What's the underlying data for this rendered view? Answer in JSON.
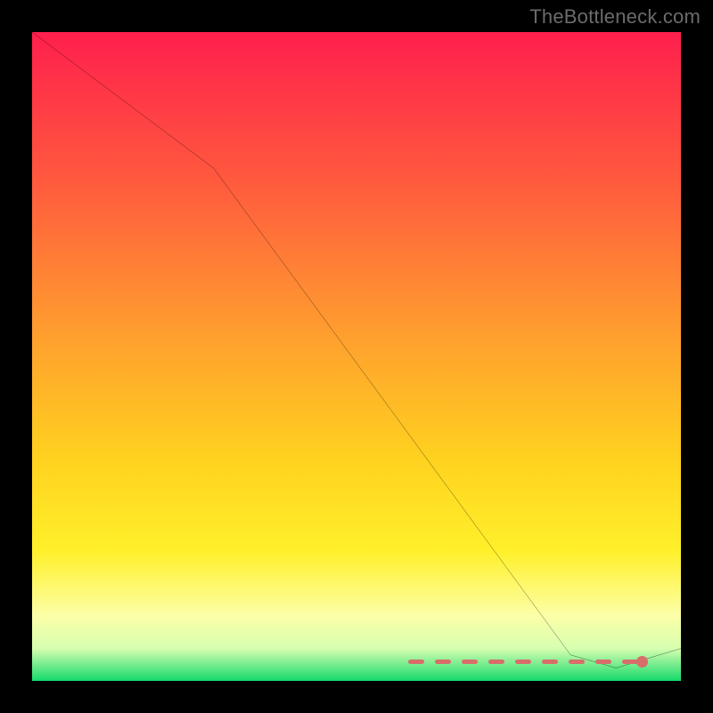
{
  "attribution": "TheBottleneck.com",
  "chart_data": {
    "type": "line",
    "title": "",
    "xlabel": "",
    "ylabel": "",
    "xlim": [
      0,
      100
    ],
    "ylim": [
      0,
      100
    ],
    "grid": false,
    "legend": false,
    "background": {
      "gradient_top": "#ff1f4d",
      "gradient_mid": "#ffd400",
      "gradient_low": "#fff9b0",
      "gradient_bottom": "#16d66a"
    },
    "series": [
      {
        "name": "curve",
        "stroke": "#000000",
        "points": [
          {
            "x": 0,
            "y": 100
          },
          {
            "x": 28,
            "y": 79
          },
          {
            "x": 83,
            "y": 4
          },
          {
            "x": 90,
            "y": 2
          },
          {
            "x": 100,
            "y": 5
          }
        ]
      }
    ],
    "threshold_line": {
      "y": 3,
      "color": "#d86d6a",
      "style": "dashed"
    },
    "marker": {
      "x": 94,
      "y": 3,
      "color": "#d86d6a"
    }
  }
}
